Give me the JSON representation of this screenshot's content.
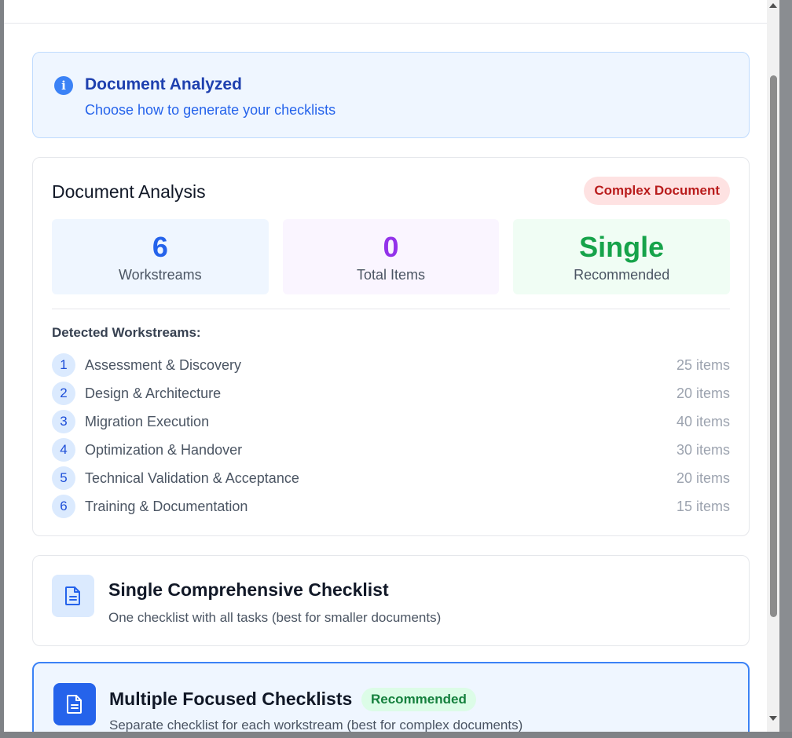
{
  "banner": {
    "icon": "info-icon",
    "title": "Document Analyzed",
    "subtitle": "Choose how to generate your checklists"
  },
  "analysis": {
    "title": "Document Analysis",
    "badge": "Complex Document",
    "stats": [
      {
        "value": "6",
        "label": "Workstreams"
      },
      {
        "value": "0",
        "label": "Total Items"
      },
      {
        "value": "Single",
        "label": "Recommended"
      }
    ],
    "workstreams_heading": "Detected Workstreams:",
    "workstreams": [
      {
        "num": "1",
        "name": "Assessment & Discovery",
        "count": "25 items"
      },
      {
        "num": "2",
        "name": "Design & Architecture",
        "count": "20 items"
      },
      {
        "num": "3",
        "name": "Migration Execution",
        "count": "40 items"
      },
      {
        "num": "4",
        "name": "Optimization & Handover",
        "count": "30 items"
      },
      {
        "num": "5",
        "name": "Technical Validation & Acceptance",
        "count": "20 items"
      },
      {
        "num": "6",
        "name": "Training & Documentation",
        "count": "15 items"
      }
    ]
  },
  "options": {
    "single": {
      "icon": "document-icon",
      "title": "Single Comprehensive Checklist",
      "description": "One checklist with all tasks (best for smaller documents)"
    },
    "multiple": {
      "icon": "document-icon",
      "title": "Multiple Focused Checklists",
      "badge": "Recommended",
      "description": "Separate checklist for each workstream (best for complex documents)"
    }
  },
  "colors": {
    "primary": "#2563eb",
    "complex_badge": "#b91c1c",
    "recommended_badge": "#15803d"
  }
}
